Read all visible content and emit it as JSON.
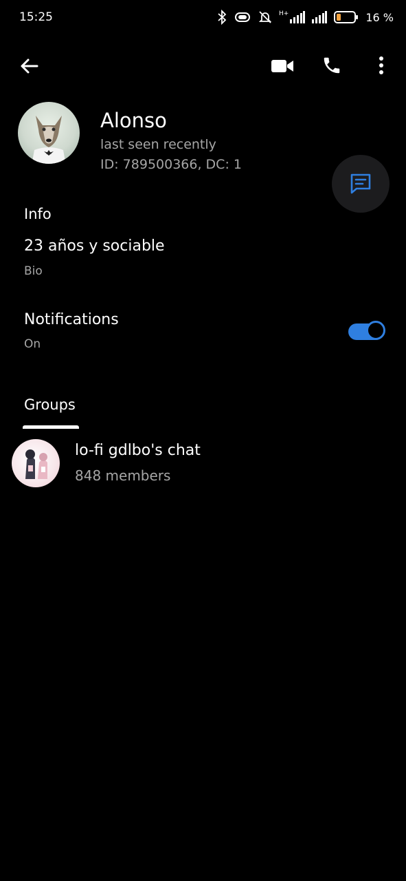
{
  "status_bar": {
    "time": "15:25",
    "battery_percent": "16 %",
    "network_label": "H+",
    "icons": [
      "bluetooth-icon",
      "vibrate-icon",
      "alarm-off-icon",
      "signal-icon",
      "signal-icon",
      "battery-icon"
    ]
  },
  "toolbar": {
    "back_icon": "arrow-back-icon",
    "video_icon": "video-call-icon",
    "call_icon": "phone-call-icon",
    "more_icon": "more-vertical-icon"
  },
  "profile": {
    "name": "Alonso",
    "last_seen": "last seen recently",
    "id_line": "ID: 789500366, DC: 1",
    "fab_icon": "message-icon"
  },
  "info": {
    "section_title": "Info",
    "bio_value": "23 años y sociable",
    "bio_label": "Bio"
  },
  "notifications": {
    "title": "Notifications",
    "state": "On",
    "enabled": true
  },
  "tabs": {
    "groups_label": "Groups"
  },
  "groups": [
    {
      "name": "lo-fi gdlbo's chat",
      "members": "848 members"
    }
  ],
  "colors": {
    "background": "#000000",
    "accent": "#2f7fe0",
    "secondary_text": "#a6a6a6",
    "fab_bg": "#1c1c1e"
  }
}
